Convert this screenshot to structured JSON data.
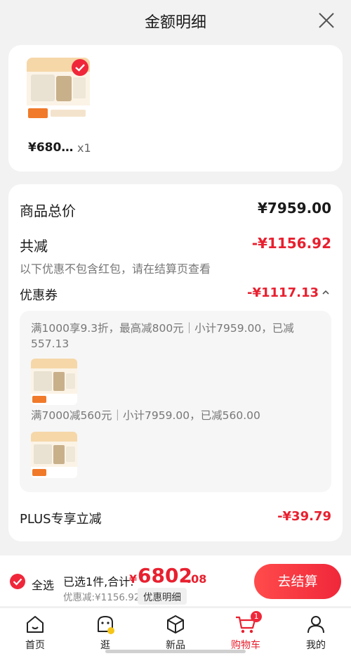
{
  "header": {
    "title": "金额明细"
  },
  "product": {
    "price": "¥680…",
    "qty": "x1"
  },
  "summary": {
    "total_label": "商品总价",
    "total_value": "¥7959.00",
    "reduce_label": "共减",
    "reduce_value": "-¥1156.92",
    "reduce_note": "以下优惠不包含红包，请在结算页查看",
    "coupon_label": "优惠券",
    "coupon_value": "-¥1117.13",
    "coupon_lines": [
      "满1000享9.3折，最高减800元｜小计7959.00，已减557.13",
      "满7000减560元｜小计7959.00，已减560.00"
    ],
    "plus_label": "PLUS专享立减",
    "plus_value": "-¥39.79"
  },
  "bottom_bar": {
    "select_all": "全选",
    "selected_text": "已选1件,合计:",
    "currency": "¥",
    "total_int": "6802",
    "total_dec": ".08",
    "discount_text": "优惠减:¥1156.92",
    "detail_tag": "优惠明细",
    "checkout_label": "去结算"
  },
  "tabs": [
    {
      "label": "首页",
      "icon": "home-icon"
    },
    {
      "label": "逛",
      "icon": "browse-icon"
    },
    {
      "label": "新品",
      "icon": "new-product-icon"
    },
    {
      "label": "购物车",
      "icon": "cart-icon",
      "badge": "1",
      "active": true
    },
    {
      "label": "我的",
      "icon": "profile-icon"
    }
  ],
  "colors": {
    "accent": "#f0273a",
    "price_red": "#e8202f",
    "background": "#f2f2f2"
  }
}
